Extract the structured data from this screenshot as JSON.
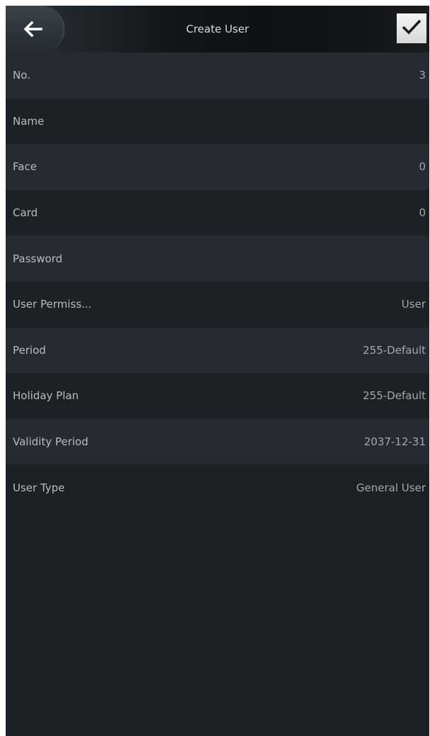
{
  "header": {
    "title": "Create User",
    "back_icon": "arrow-left-icon",
    "confirm_icon": "checkmark-icon"
  },
  "fields": [
    {
      "label": "No.",
      "value": "3"
    },
    {
      "label": "Name",
      "value": ""
    },
    {
      "label": "Face",
      "value": "0"
    },
    {
      "label": "Card",
      "value": "0"
    },
    {
      "label": "Password",
      "value": ""
    },
    {
      "label": "User Permiss...",
      "value": "User"
    },
    {
      "label": "Period",
      "value": "255-Default"
    },
    {
      "label": "Holiday Plan",
      "value": "255-Default"
    },
    {
      "label": "Validity Period",
      "value": "2037-12-31"
    },
    {
      "label": "User Type",
      "value": "General User"
    }
  ],
  "colors": {
    "background": "#1c2126",
    "row_alt": "#252b30",
    "text": "#b9bcbe"
  }
}
